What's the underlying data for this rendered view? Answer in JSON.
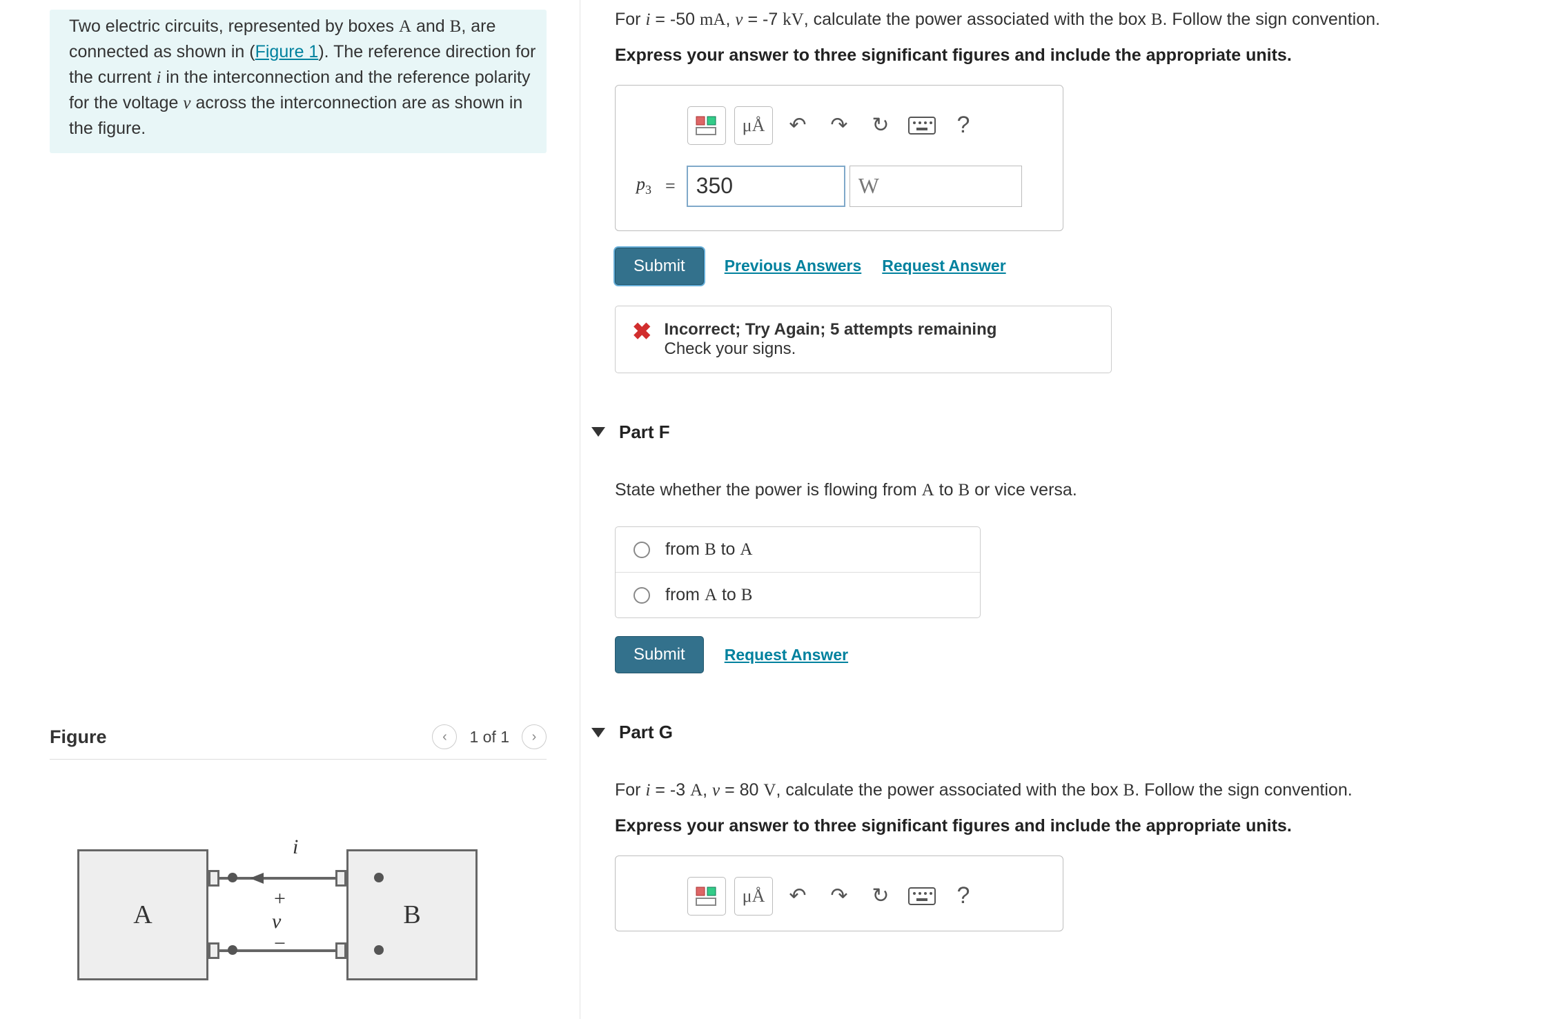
{
  "intro": {
    "pre_a": "Two electric circuits, represented by boxes ",
    "A": "A",
    "and": " and ",
    "B": "B",
    "post_b_1": ", are connected as shown in (",
    "fig_link": "Figure 1",
    "post_b_2": "). The reference direction for the current ",
    "i": "i",
    "post_i": " in the interconnection and the reference polarity for the voltage ",
    "v": "v",
    "post_v": " across the interconnection are as shown in the figure."
  },
  "figure": {
    "title": "Figure",
    "nav_text": "1 of 1",
    "labels": {
      "A": "A",
      "B": "B",
      "i": "i",
      "v": "v",
      "plus": "+",
      "minus": "−"
    }
  },
  "partE": {
    "prompt_pre": "For ",
    "i_expr": "i",
    "eq1": " = -50 ",
    "i_unit": "mA",
    "comma": ", ",
    "v_expr": "v",
    "eq2": " = -7 ",
    "v_unit": "kV",
    "prompt_post_1": ", calculate the power associated with the box ",
    "B": "B",
    "prompt_post_2": ". Follow the sign convention.",
    "instr": "Express your answer to three significant figures and include the appropriate units.",
    "toolbar": {
      "units_symbol": "μÅ",
      "help": "?"
    },
    "var_sym": "p",
    "var_sub": "3",
    "equals": "=",
    "value": "350",
    "unit": "W",
    "submit": "Submit",
    "prev": "Previous Answers",
    "req": "Request Answer",
    "fb_title": "Incorrect; Try Again; 5 attempts remaining",
    "fb_body": "Check your signs."
  },
  "partF": {
    "title": "Part F",
    "prompt_pre": "State whether the power is flowing from ",
    "A": "A",
    "to": " to ",
    "B": "B",
    "prompt_post": " or vice versa.",
    "opt1_pre": "from ",
    "opt1_A": "B",
    "opt1_to": " to ",
    "opt1_B": "A",
    "opt2_pre": "from ",
    "opt2_A": "A",
    "opt2_to": " to ",
    "opt2_B": "B",
    "submit": "Submit",
    "req": "Request Answer"
  },
  "partG": {
    "title": "Part G",
    "prompt_pre": "For ",
    "i_expr": "i",
    "eq1": " = -3 ",
    "i_unit": "A",
    "comma": ", ",
    "v_expr": "v",
    "eq2": " = 80 ",
    "v_unit": "V",
    "prompt_post_1": ", calculate the power associated with the box ",
    "B": "B",
    "prompt_post_2": ". Follow the sign convention.",
    "instr": "Express your answer to three significant figures and include the appropriate units.",
    "toolbar": {
      "units_symbol": "μÅ",
      "help": "?"
    }
  }
}
